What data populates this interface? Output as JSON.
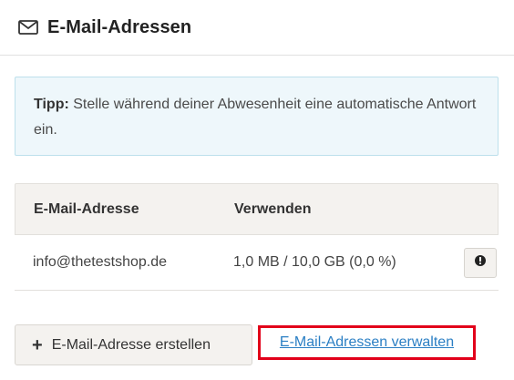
{
  "header": {
    "icon": "envelope-icon",
    "title": "E-Mail-Adressen"
  },
  "tip": {
    "label": "Tipp:",
    "text": " Stelle während deiner Abwesenheit eine automatische Antwort ein."
  },
  "table": {
    "columns": [
      "E-Mail-Adresse",
      "Verwenden"
    ],
    "rows": [
      {
        "address": "info@thetestshop.de",
        "usage": "1,0 MB / 10,0 GB (0,0 %)",
        "action_icon": "exclamation-icon"
      }
    ]
  },
  "actions": {
    "create_icon": "plus-icon",
    "create_label": "E-Mail-Adresse erstellen",
    "manage_label": "E-Mail-Adressen verwalten"
  },
  "colors": {
    "highlight_border": "#e2001a",
    "link": "#2b7fc4",
    "tip_background": "#eef7fb"
  }
}
